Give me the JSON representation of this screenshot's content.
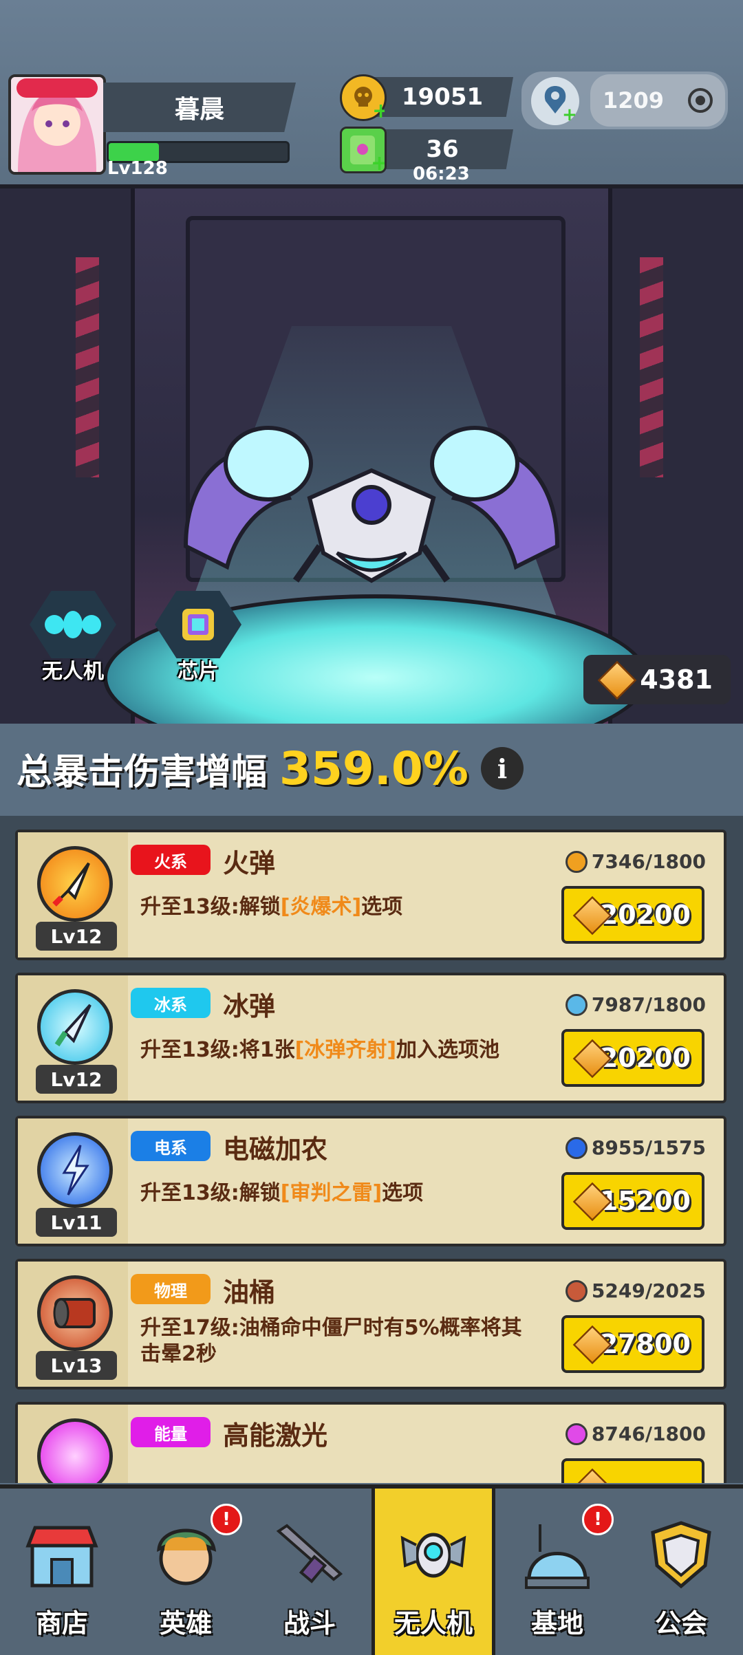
{
  "player": {
    "name": "暮晨",
    "level": "Lv128",
    "xp_fraction": 0.28
  },
  "resources": {
    "coins": "19051",
    "energy": "36",
    "energy_timer": "06:23",
    "gems": "1209"
  },
  "scene": {
    "mode_buttons": [
      {
        "label": "无人机"
      },
      {
        "label": "芯片"
      }
    ],
    "cube_count": "4381"
  },
  "stat": {
    "label": "总暴击伤害增幅",
    "value": "359.0%",
    "info_icon": "i"
  },
  "items": [
    {
      "level": "Lv12",
      "tag": "火系",
      "tag_color": "#e8141c",
      "title": "火弹",
      "desc_prefix": "升至13级:解锁",
      "desc_highlight": "[炎爆术]",
      "desc_suffix": "选项",
      "fragments": "7346/1800",
      "cost": "20200",
      "icon": "rocket-icon"
    },
    {
      "level": "Lv12",
      "tag": "冰系",
      "tag_color": "#1fc8ee",
      "title": "冰弹",
      "desc_prefix": "升至13级:将1张",
      "desc_highlight": "[冰弹齐射]",
      "desc_suffix": "加入选项池",
      "fragments": "7987/1800",
      "cost": "20200",
      "icon": "ice-missile-icon"
    },
    {
      "level": "Lv11",
      "tag": "电系",
      "tag_color": "#1b7fe6",
      "title": "电磁加农",
      "desc_prefix": "升至13级:解锁",
      "desc_highlight": "[审判之雷]",
      "desc_suffix": "选项",
      "fragments": "8955/1575",
      "cost": "15200",
      "icon": "lightning-icon"
    },
    {
      "level": "Lv13",
      "tag": "物理",
      "tag_color": "#f29a1a",
      "title": "油桶",
      "desc_prefix": "升至17级:油桶命中僵尸时有5%概率将其击晕2秒",
      "desc_highlight": "",
      "desc_suffix": "",
      "fragments": "5249/2025",
      "cost": "27800",
      "icon": "oil-barrel-icon"
    },
    {
      "level": "",
      "tag": "能量",
      "tag_color": "#e01ee8",
      "title": "高能激光",
      "desc_prefix": "",
      "desc_highlight": "",
      "desc_suffix": "",
      "fragments": "8746/1800",
      "cost": "",
      "icon": "laser-icon"
    }
  ],
  "nav": [
    {
      "label": "商店",
      "icon": "shop-icon",
      "badge": ""
    },
    {
      "label": "英雄",
      "icon": "hero-icon",
      "badge": "!"
    },
    {
      "label": "战斗",
      "icon": "rifle-icon",
      "badge": ""
    },
    {
      "label": "无人机",
      "icon": "drone-icon",
      "badge": "",
      "active": true
    },
    {
      "label": "基地",
      "icon": "base-dome-icon",
      "badge": "!"
    },
    {
      "label": "公会",
      "icon": "guild-shield-icon",
      "badge": ""
    }
  ]
}
